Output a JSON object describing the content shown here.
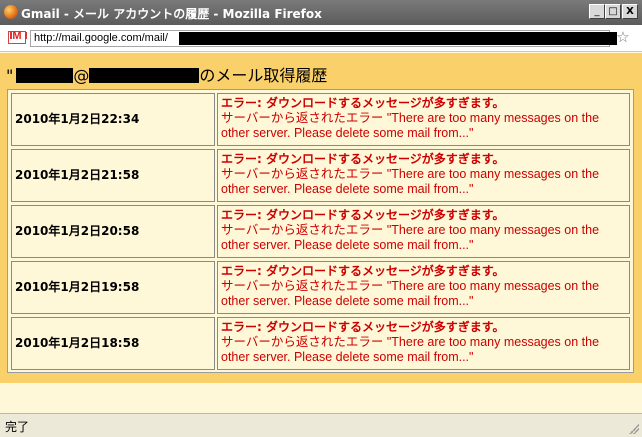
{
  "window": {
    "title": "Gmail - メール アカウントの履歴 - Mozilla Firefox",
    "minimize": "_",
    "maximize": "□",
    "close": "X"
  },
  "urlbar": {
    "url": "http://mail.google.com/mail/"
  },
  "page": {
    "heading_prefix": "\"",
    "heading_at": "@",
    "heading_suffix": "のメール取得履歴",
    "rows": [
      {
        "date": "2010年1月2日22:34",
        "error_title": "エラー: ダウンロードするメッセージが多すぎます。",
        "error_body": "サーバーから返されたエラー \"There are too many messages on the other server. Please delete some mail from...\""
      },
      {
        "date": "2010年1月2日21:58",
        "error_title": "エラー: ダウンロードするメッセージが多すぎます。",
        "error_body": "サーバーから返されたエラー \"There are too many messages on the other server. Please delete some mail from...\""
      },
      {
        "date": "2010年1月2日20:58",
        "error_title": "エラー: ダウンロードするメッセージが多すぎます。",
        "error_body": "サーバーから返されたエラー \"There are too many messages on the other server. Please delete some mail from...\""
      },
      {
        "date": "2010年1月2日19:58",
        "error_title": "エラー: ダウンロードするメッセージが多すぎます。",
        "error_body": "サーバーから返されたエラー \"There are too many messages on the other server. Please delete some mail from...\""
      },
      {
        "date": "2010年1月2日18:58",
        "error_title": "エラー: ダウンロードするメッセージが多すぎます。",
        "error_body": "サーバーから返されたエラー \"There are too many messages on the other server. Please delete some mail from...\""
      }
    ]
  },
  "status": {
    "text": "完了"
  },
  "colors": {
    "page_background": "#fad06b",
    "table_background": "#fff8d8",
    "error_text": "#cc0000"
  }
}
